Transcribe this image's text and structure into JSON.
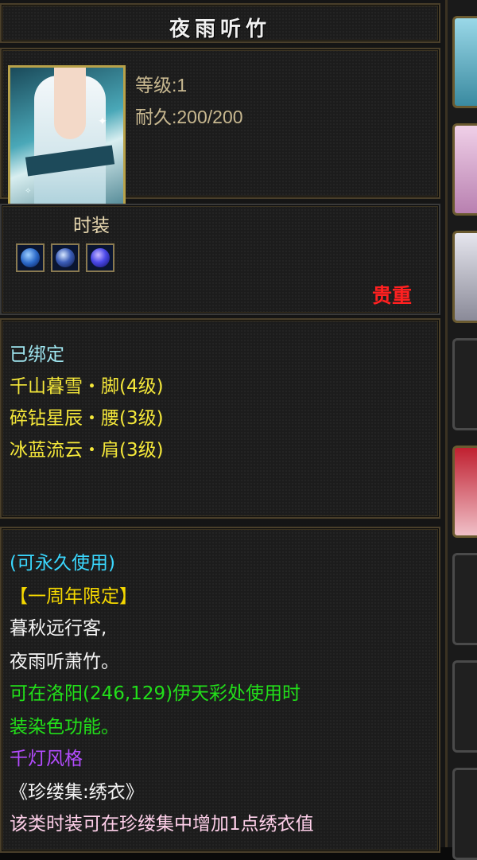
{
  "item": {
    "name": "夜雨听竹",
    "level_label": "等级:1",
    "durability_label": "耐久:200/200",
    "category": "时装",
    "rarity": "贵重"
  },
  "gems": [
    {
      "icon": "blue-gem-icon"
    },
    {
      "icon": "star-gem-icon"
    },
    {
      "icon": "purple-gem-icon"
    }
  ],
  "binding": {
    "status": "已绑定",
    "sets": [
      "千山暮雪・脚(4级)",
      "碎钻星辰・腰(3级)",
      "冰蓝流云・肩(3级)"
    ]
  },
  "description": {
    "usage": "(可永久使用)",
    "limited": "【一周年限定】",
    "poem_1": "暮秋远行客,",
    "poem_2": "夜雨听萧竹。",
    "dye_1": "可在洛阳(246,129)伊天彩处使用时",
    "dye_2": "装染色功能。",
    "style": "千灯风格",
    "collection": "《珍缕集:绣衣》",
    "collection_desc": "该类时装可在珍缕集中增加1点绣衣值"
  },
  "colors": {
    "rarity": "#ff2020",
    "set_line": "#f5e83a",
    "dye_line": "#22e01a",
    "style_line": "#b44cff"
  }
}
